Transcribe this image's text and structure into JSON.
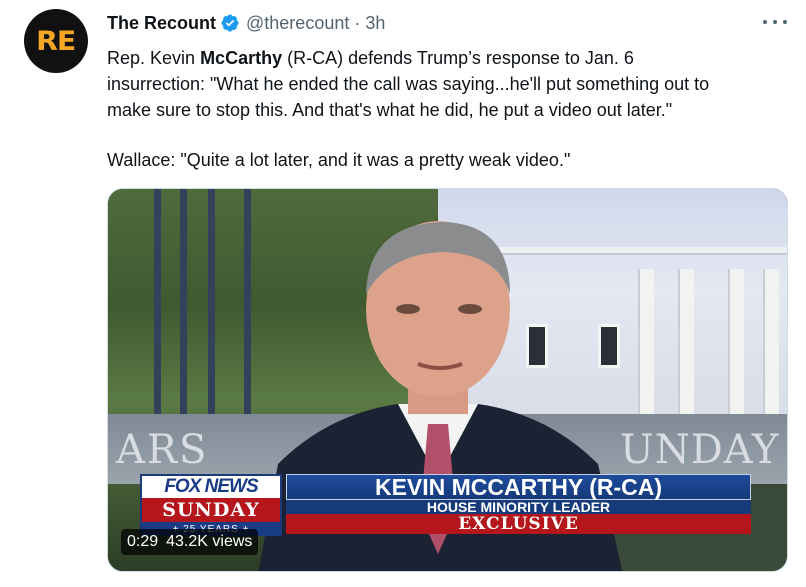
{
  "account": {
    "avatar_text": "RE",
    "display_name": "The Recount",
    "handle": "@therecount",
    "separator": "·",
    "time": "3h"
  },
  "tweet": {
    "line1_pre": "Rep. Kevin ",
    "line1_bold": "McCarthy",
    "line1_post": " (R-CA) defends Trump’s response to Jan. 6",
    "line2": "insurrection: \"What he ended the call was saying...he'll put something out to",
    "line3": "make sure to stop this. And that's what he did, he put a video out later.\"",
    "line4": "Wallace: \"Quite a lot later, and it was a pretty weak video.\""
  },
  "video": {
    "set_text_left": "ARS",
    "set_text_right": "UNDAY",
    "logo_top": "FOX NEWS",
    "logo_bottom": "SUNDAY",
    "logo_years": "+ 25 YEARS +",
    "name": "KEVIN MCCARTHY (R-CA)",
    "title": "HOUSE MINORITY LEADER",
    "exclusive": "EXCLUSIVE",
    "duration": "0:29",
    "views": "43.2K views"
  },
  "colors": {
    "verified": "#1d9bf0",
    "secondary_text": "#536471",
    "fox_blue": "#1a3c86",
    "fox_red": "#b5161b"
  },
  "icons": {
    "verified": "verified-badge-icon",
    "more": "more-options-icon"
  }
}
